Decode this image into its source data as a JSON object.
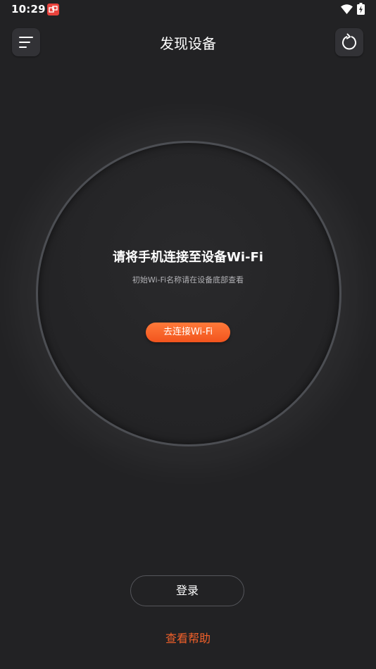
{
  "status_bar": {
    "time": "10:29"
  },
  "header": {
    "title": "发现设备",
    "menu_icon": "menu-lines-icon",
    "refresh_icon": "refresh-icon"
  },
  "connect_card": {
    "title": "请将手机连接至设备Wi-Fi",
    "subtitle": "初始Wi-Fi名称请在设备底部查看",
    "button_label": "去连接Wi-Fi"
  },
  "footer": {
    "login_label": "登录",
    "help_label": "查看帮助"
  },
  "colors": {
    "background": "#222224",
    "accent": "#f2541e",
    "help_link": "#f0602a",
    "notification_badge": "#e9423c"
  }
}
